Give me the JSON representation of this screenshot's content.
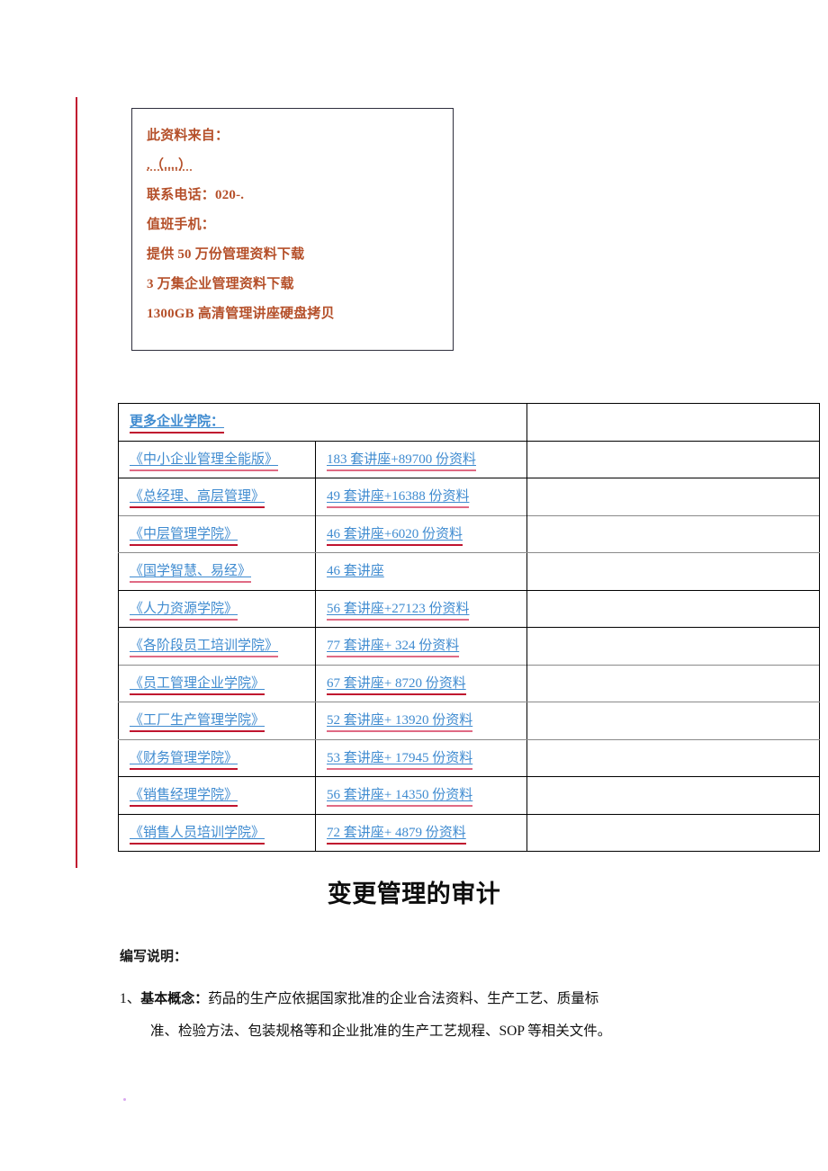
{
  "promo_box": {
    "lines": [
      {
        "text": "此资料来自：",
        "dotted": false
      },
      {
        "text": ".（....）",
        "dotted": true
      },
      {
        "text": "联系电话：020-.",
        "dotted": false
      },
      {
        "text": "值班手机：",
        "dotted": false
      },
      {
        "text": "提供 50 万份管理资料下载",
        "dotted": false
      },
      {
        "text": "3 万集企业管理资料下载",
        "dotted": false
      },
      {
        "text": "1300GB 高清管理讲座硬盘拷贝",
        "dotted": false
      }
    ],
    "text_color": "#b5502a",
    "border_color": "#2f2f3d"
  },
  "academy_table": {
    "header": "更多企业学院：",
    "link_color": "#3f8bd0",
    "spellcheck_color": "#c0142f",
    "rows": [
      {
        "name": "《中小企业管理全能版》",
        "detail": "183 套讲座+89700 份资料",
        "note": ""
      },
      {
        "name": "《总经理、高层管理》",
        "detail": "49 套讲座+16388 份资料",
        "note": ""
      },
      {
        "name": "《中层管理学院》",
        "detail": "46 套讲座+6020 份资料",
        "note": ""
      },
      {
        "name": "《国学智慧、易经》",
        "detail": "46 套讲座",
        "note": ""
      },
      {
        "name": "《人力资源学院》",
        "detail": "56 套讲座+27123 份资料",
        "note": ""
      },
      {
        "name": "《各阶段员工培训学院》",
        "detail": "77 套讲座+ 324 份资料",
        "note": ""
      },
      {
        "name": "《员工管理企业学院》",
        "detail": "67 套讲座+ 8720 份资料",
        "note": ""
      },
      {
        "name": "《工厂生产管理学院》",
        "detail": "52 套讲座+ 13920 份资料",
        "note": ""
      },
      {
        "name": "《财务管理学院》",
        "detail": "53 套讲座+ 17945 份资料",
        "note": ""
      },
      {
        "name": "《销售经理学院》",
        "detail": "56 套讲座+ 14350 份资料",
        "note": ""
      },
      {
        "name": "《销售人员培训学院》",
        "detail": "72 套讲座+ 4879 份资料",
        "note": ""
      }
    ]
  },
  "document": {
    "title": "变更管理的审计",
    "subhead": "编写说明：",
    "item_number": "1、",
    "item_term": "基本概念：",
    "item_line1": "药品的生产应依据国家批准的企业合法资料、生产工艺、质量标",
    "item_line2": "准、检验方法、包装规格等和企业批准的生产工艺规程、SOP 等相关文件。"
  }
}
